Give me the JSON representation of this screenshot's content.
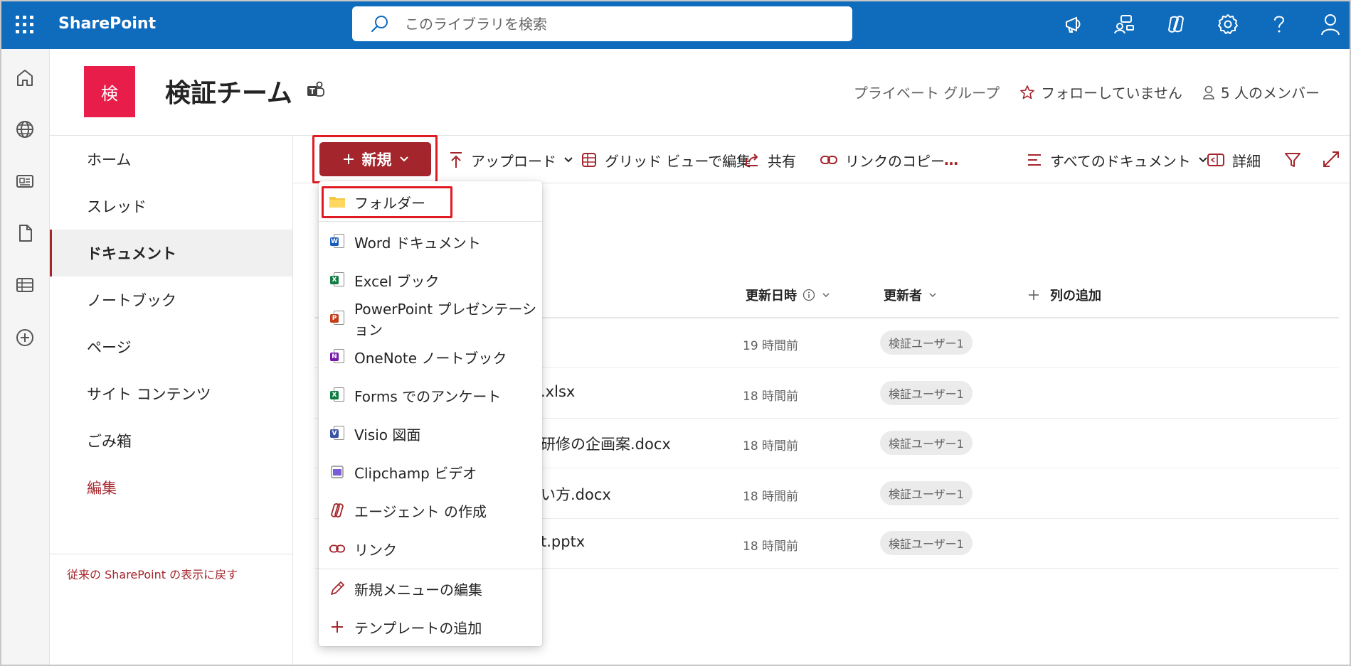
{
  "topbar": {
    "brand": "SharePoint",
    "search_placeholder": "このライブラリを検索",
    "icons": [
      "megaphone-icon",
      "people-settings-icon",
      "copilot-icon",
      "settings-icon",
      "help-icon",
      "account-icon"
    ]
  },
  "appbar": {
    "icons": [
      "home-icon",
      "globe-icon",
      "news-icon",
      "files-icon",
      "lists-icon",
      "create-icon"
    ]
  },
  "site": {
    "logo_letter": "検",
    "title": "検証チーム",
    "privacy": "プライベート グループ",
    "follow": "フォローしていません",
    "members": "5 人のメンバー"
  },
  "leftnav": {
    "items": [
      {
        "label": "ホーム"
      },
      {
        "label": "スレッド"
      },
      {
        "label": "ドキュメント"
      },
      {
        "label": "ノートブック"
      },
      {
        "label": "ページ"
      },
      {
        "label": "サイト コンテンツ"
      },
      {
        "label": "ごみ箱"
      },
      {
        "label": "編集"
      }
    ],
    "classic_link": "従来の SharePoint の表示に戻す"
  },
  "commandbar": {
    "new": "新規",
    "upload": "アップロード",
    "grid_edit": "グリッド ビューで編集",
    "share": "共有",
    "copy_link": "リンクのコピー",
    "more": "…",
    "view": "すべてのドキュメント",
    "details": "詳細"
  },
  "list": {
    "headers": {
      "modified": "更新日時",
      "modified_by": "更新者",
      "add_column": "列の追加"
    },
    "rows": [
      {
        "name": "",
        "modified": "19 時間前",
        "by": "検証ユーザー1"
      },
      {
        "name": ".xlsx",
        "modified": "18 時間前",
        "by": "検証ユーザー1"
      },
      {
        "name": "研修の企画案.docx",
        "modified": "18 時間前",
        "by": "検証ユーザー1"
      },
      {
        "name": "い方.docx",
        "modified": "18 時間前",
        "by": "検証ユーザー1"
      },
      {
        "name": "t.pptx",
        "modified": "18 時間前",
        "by": "検証ユーザー1"
      }
    ]
  },
  "new_menu": {
    "items": [
      {
        "label": "フォルダー",
        "icon": "folder-icon"
      },
      {
        "label": "Word ドキュメント",
        "icon": "word-icon"
      },
      {
        "label": "Excel ブック",
        "icon": "excel-icon"
      },
      {
        "label": "PowerPoint プレゼンテーション",
        "icon": "powerpoint-icon"
      },
      {
        "label": "OneNote ノートブック",
        "icon": "onenote-icon"
      },
      {
        "label": "Forms でのアンケート",
        "icon": "forms-icon"
      },
      {
        "label": "Visio 図面",
        "icon": "visio-icon"
      },
      {
        "label": "Clipchamp ビデオ",
        "icon": "clipchamp-icon"
      },
      {
        "label": "エージェント の作成",
        "icon": "agent-icon"
      },
      {
        "label": "リンク",
        "icon": "link-icon"
      },
      {
        "label": "新規メニューの編集",
        "icon": "pencil-icon"
      },
      {
        "label": "テンプレートの追加",
        "icon": "plus-icon"
      }
    ]
  },
  "colors": {
    "topbar": "#0f6cbd",
    "accent": "#a4262c",
    "site_logo": "#e81d49",
    "highlight": "#e01b24"
  }
}
